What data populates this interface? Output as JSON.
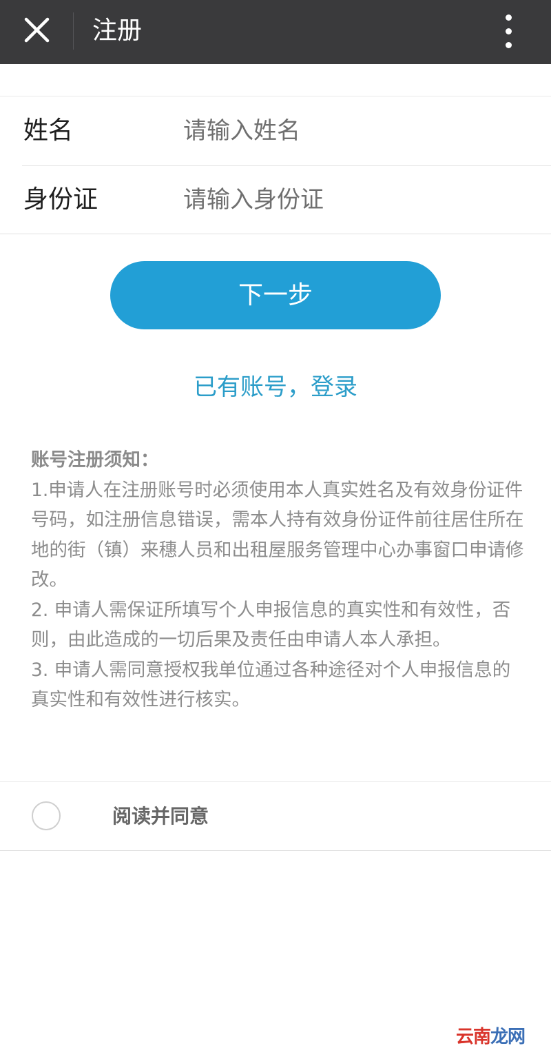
{
  "header": {
    "title": "注册"
  },
  "form": {
    "name_label": "姓名",
    "name_placeholder": "请输入姓名",
    "id_label": "身份证",
    "id_placeholder": "请输入身份证"
  },
  "actions": {
    "next_label": "下一步",
    "login_link": "已有账号，登录"
  },
  "notice": {
    "title": "账号注册须知：",
    "items": [
      "1.申请人在注册账号时必须使用本人真实姓名及有效身份证件号码，如注册信息错误，需本人持有效身份证件前往居住所在地的街（镇）来穗人员和出租屋服务管理中心办事窗口申请修改。",
      "2. 申请人需保证所填写个人申报信息的真实性和有效性，否则，由此造成的一切后果及责任由申请人本人承担。",
      "3. 申请人需同意授权我单位通过各种途径对个人申报信息的真实性和有效性进行核实。"
    ]
  },
  "agreement": {
    "label": "阅读并同意",
    "checked": false
  },
  "watermark": {
    "text_red": "云南",
    "text_blue": "龙网"
  },
  "colors": {
    "topbar": "#3a3a3c",
    "accent": "#229fd6",
    "link": "#2b9dc9",
    "notice_text": "#8c8c8c"
  }
}
